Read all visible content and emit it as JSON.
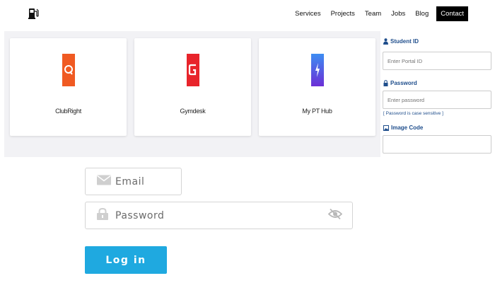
{
  "nav": {
    "items": [
      "Services",
      "Projects",
      "Team",
      "Jobs",
      "Blog"
    ],
    "contact": "Contact"
  },
  "cards": [
    {
      "label": "ClubRight",
      "icon": "clubright-logo-icon",
      "color": "#f05a22"
    },
    {
      "label": "Gymdesk",
      "icon": "gymdesk-logo-icon",
      "color": "#e8242b"
    },
    {
      "label": "My PT Hub",
      "icon": "myptHub-logo-icon",
      "color": "#5a3fd8"
    }
  ],
  "side_form": {
    "student_id_label": "Student ID",
    "student_id_placeholder": "Enter Portal ID",
    "password_label": "Password",
    "password_placeholder": "Enter password",
    "password_note": "[ Password is case sensitive ]",
    "image_code_label": "Image Code"
  },
  "login": {
    "email_placeholder": "Email",
    "password_placeholder": "Password",
    "button_label": "Log in"
  },
  "colors": {
    "accent": "#1fa9e0",
    "label_blue": "#1f4e8c"
  }
}
